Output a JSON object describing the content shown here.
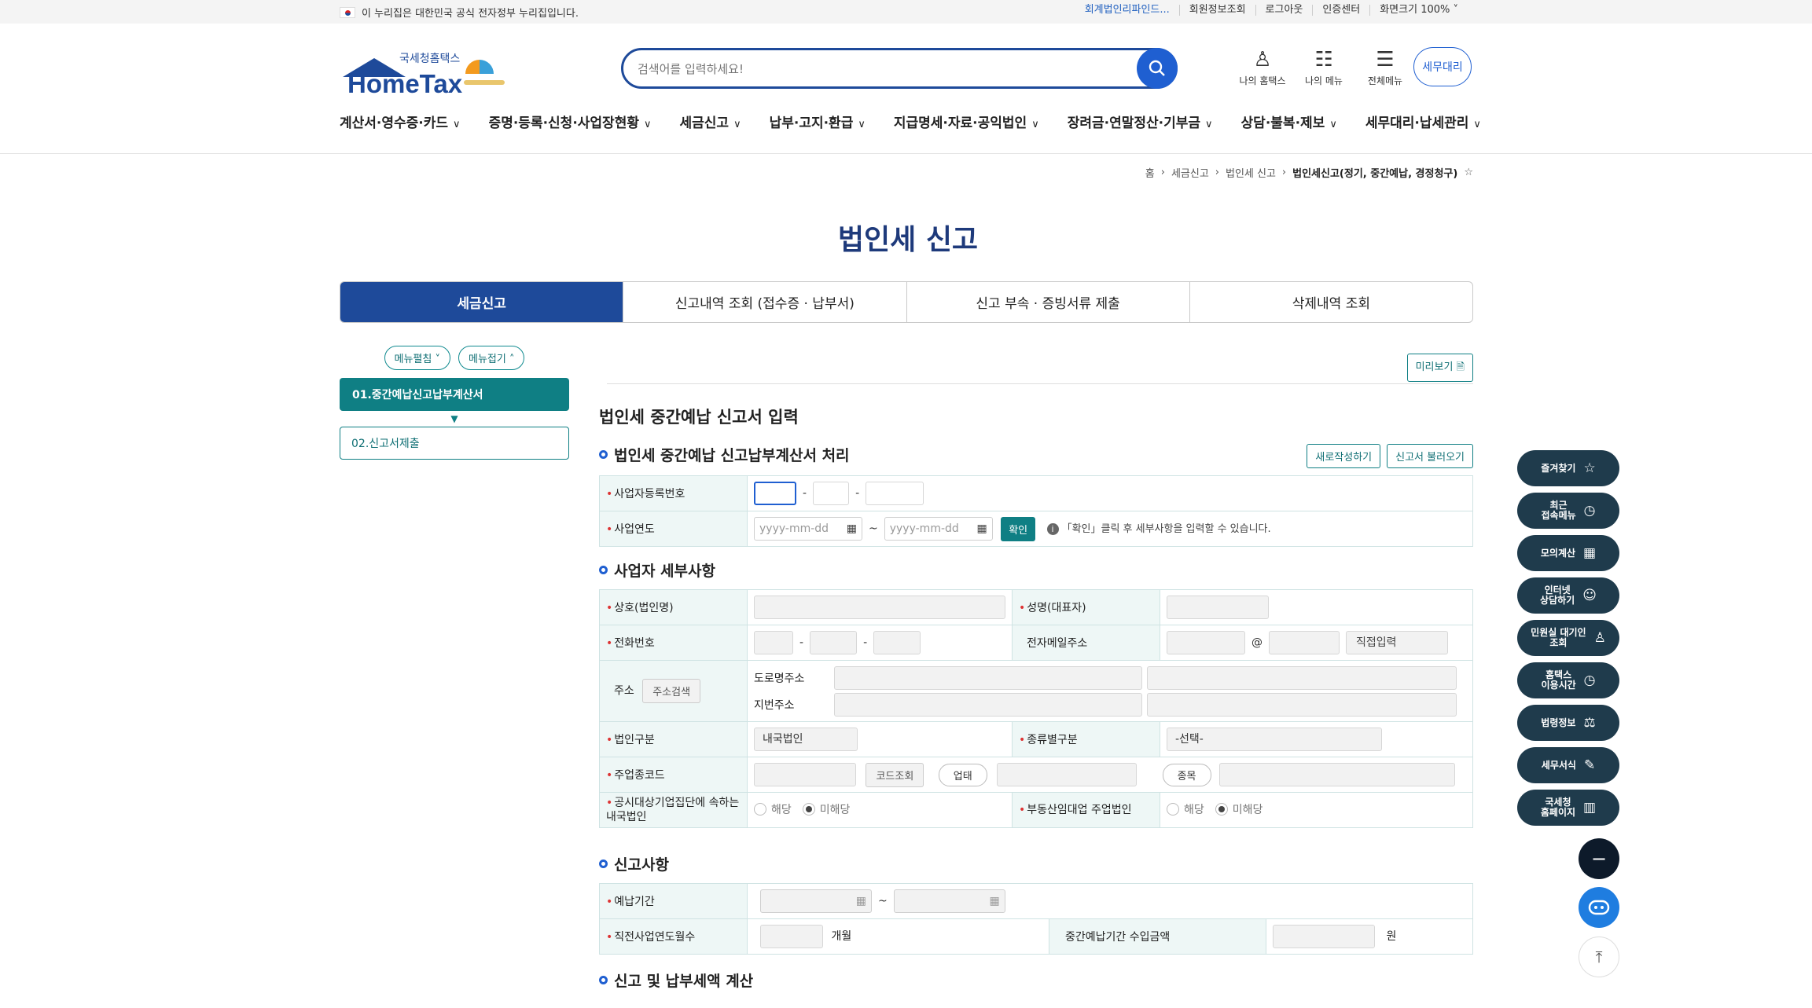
{
  "topbar": {
    "gov_text": "이 누리집은 대한민국 공식 전자정부 누리집입니다.",
    "links": [
      "회계법인리파인드...",
      "회원정보조회",
      "로그아웃",
      "인증센터",
      "화면크기 100% ˅"
    ]
  },
  "logo": {
    "sub": "국세청홈택스",
    "brand": "HomeTax"
  },
  "search": {
    "placeholder": "검색어를 입력하세요!"
  },
  "header_icons": [
    "나의 홈택스",
    "나의 메뉴",
    "전체메뉴"
  ],
  "semu_button": "세무대리",
  "gnb": [
    "계산서·영수증·카드",
    "증명·등록·신청·사업장현황",
    "세금신고",
    "납부·고지·환급",
    "지급명세·자료·공익법인",
    "장려금·연말정산·기부금",
    "상담·불복·제보",
    "세무대리·납세관리"
  ],
  "breadcrumb": [
    "홈",
    "세금신고",
    "법인세 신고",
    "법인세신고(정기, 중간예납, 경정청구)"
  ],
  "page_title": "법인세 신고",
  "tabs": [
    "세금신고",
    "신고내역 조회 (접수증 · 납부서)",
    "신고 부속 · 증빙서류 제출",
    "삭제내역 조회"
  ],
  "side": {
    "expand": "메뉴펼침 ˅",
    "collapse": "메뉴접기 ˄",
    "step1": "01.중간예납신고납부계산서",
    "arrow": "▼",
    "step2": "02.신고서제출"
  },
  "main": {
    "preview": "미리보기",
    "heading": "법인세 중간예납 신고서 입력",
    "sec1": {
      "title": "법인세 중간예납 신고납부계산서 처리",
      "btn_new": "새로작성하기",
      "btn_load": "신고서 불러오기",
      "biz_no_label": "사업자등록번호",
      "year_label": "사업연도",
      "date_placeholder": "yyyy-mm-dd",
      "confirm": "확인",
      "note": "「확인」클릭 후 세부사항을 입력할 수 있습니다."
    },
    "sec2": {
      "title": "사업자 세부사항",
      "company": "상호(법인명)",
      "ceo": "성명(대표자)",
      "phone": "전화번호",
      "email": "전자메일주소",
      "at": "@",
      "direct": "직접입력",
      "address": "주소",
      "addr_search": "주소검색",
      "road": "도로명주소",
      "lot": "지번주소",
      "corp_type": "법인구분",
      "corp_type_val": "내국법인",
      "kind": "종류별구분",
      "kind_val": "-선택-",
      "industry": "주업종코드",
      "code_search": "코드조회",
      "biz_type": "업태",
      "item": "종목",
      "public": "공시대상기업집단에 속하는 내국법인",
      "realestate": "부동산임대업 주업법인",
      "yes": "해당",
      "no": "미해당"
    },
    "sec3": {
      "title": "신고사항",
      "period": "예납기간",
      "months_label": "직전사업연도월수",
      "months_unit": "개월",
      "income_label": "중간예납기간 수입금액",
      "won": "원"
    },
    "sec4": {
      "title": "신고 및 납부세액 계산"
    }
  },
  "quick": [
    [
      "즐겨찾기",
      "☆"
    ],
    [
      "최근\n접속메뉴",
      "◷"
    ],
    [
      "모의계산",
      "▦"
    ],
    [
      "인터넷\n상담하기",
      "☺"
    ],
    [
      "민원실 대기인\n조회",
      "♙"
    ],
    [
      "홈택스\n이용시간",
      "◷"
    ],
    [
      "법령정보",
      "⚖"
    ],
    [
      "세무서식",
      "✎"
    ],
    [
      "국세청\n홈페이지",
      "▥"
    ]
  ],
  "fab_minus": "−"
}
